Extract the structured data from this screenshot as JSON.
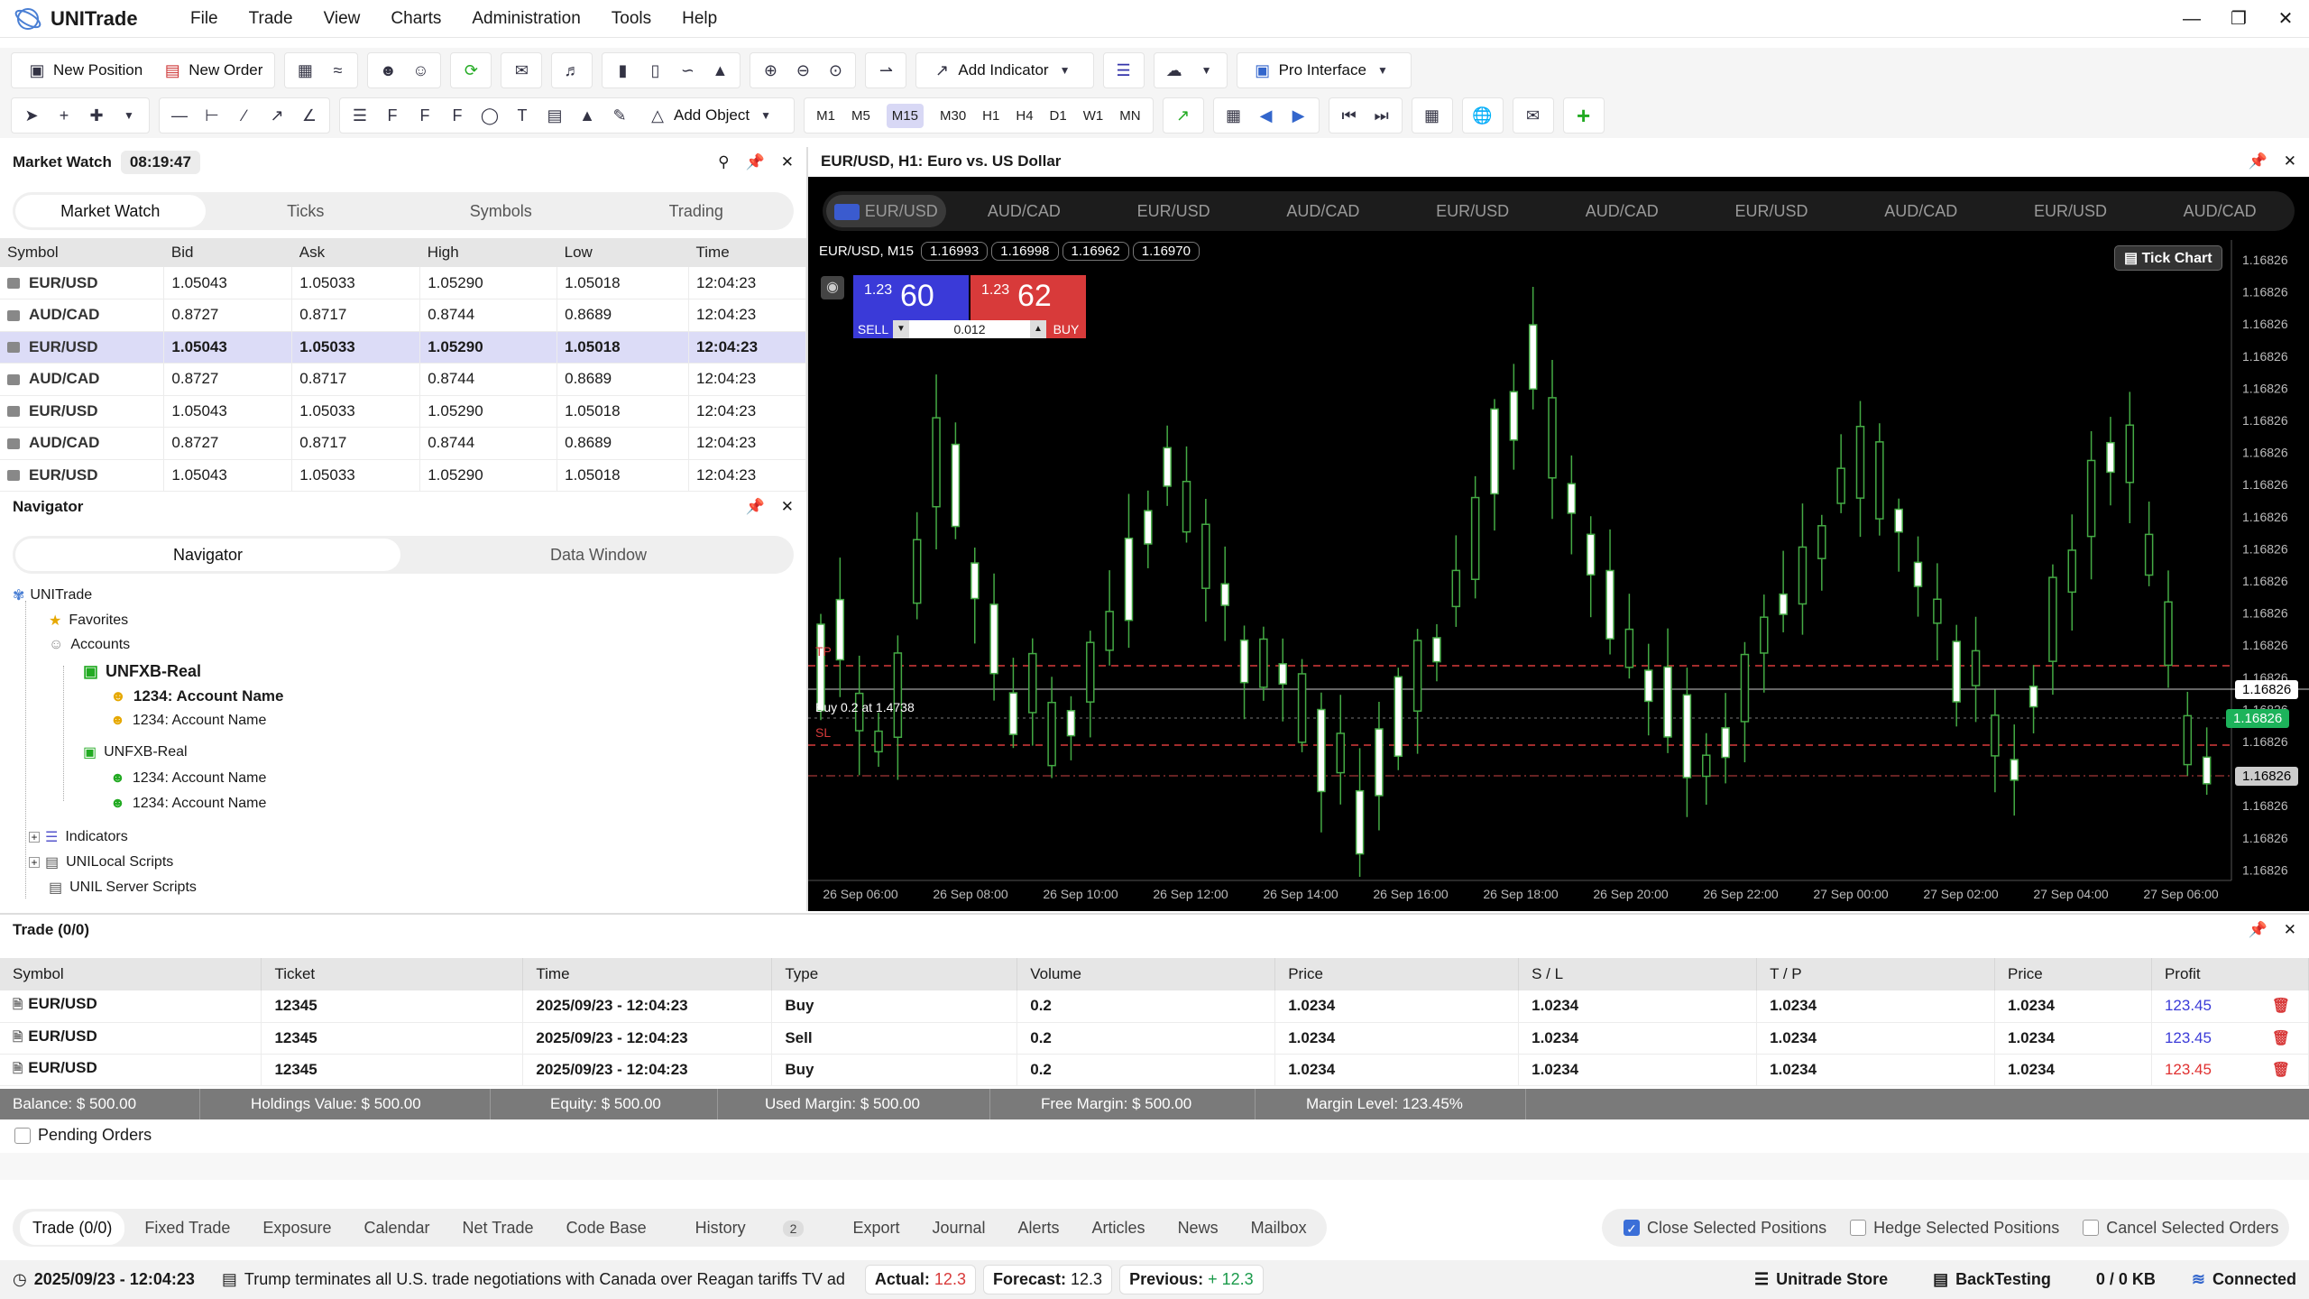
{
  "app": {
    "title": "UNITrade"
  },
  "menu": [
    "File",
    "Trade",
    "View",
    "Charts",
    "Administration",
    "Tools",
    "Help"
  ],
  "toolbar": {
    "new_position": "New Position",
    "new_order": "New Order",
    "add_indicator": "Add Indicator",
    "pro_interface": "Pro Interface",
    "add_object": "Add Object"
  },
  "timeframes": [
    "M1",
    "M5",
    "M15",
    "M30",
    "H1",
    "H4",
    "D1",
    "W1",
    "MN"
  ],
  "selected_timeframe": "M15",
  "market_watch": {
    "title": "Market Watch",
    "time": "08:19:47",
    "tabs": [
      "Market Watch",
      "Ticks",
      "Symbols",
      "Trading"
    ],
    "columns": [
      "Symbol",
      "Bid",
      "Ask",
      "High",
      "Low",
      "Time"
    ],
    "rows": [
      [
        "EUR/USD",
        "1.05043",
        "1.05033",
        "1.05290",
        "1.05018",
        "12:04:23"
      ],
      [
        "AUD/CAD",
        "0.8727",
        "0.8717",
        "0.8744",
        "0.8689",
        "12:04:23"
      ],
      [
        "EUR/USD",
        "1.05043",
        "1.05033",
        "1.05290",
        "1.05018",
        "12:04:23"
      ],
      [
        "AUD/CAD",
        "0.8727",
        "0.8717",
        "0.8744",
        "0.8689",
        "12:04:23"
      ],
      [
        "EUR/USD",
        "1.05043",
        "1.05033",
        "1.05290",
        "1.05018",
        "12:04:23"
      ],
      [
        "AUD/CAD",
        "0.8727",
        "0.8717",
        "0.8744",
        "0.8689",
        "12:04:23"
      ],
      [
        "EUR/USD",
        "1.05043",
        "1.05033",
        "1.05290",
        "1.05018",
        "12:04:23"
      ]
    ]
  },
  "navigator": {
    "title": "Navigator",
    "tabs": [
      "Navigator",
      "Data Window"
    ],
    "root": "UNITrade",
    "favorites": "Favorites",
    "accounts": "Accounts",
    "real1": "UNFXB-Real",
    "acc1": "1234: Account Name",
    "acc2": "1234: Account Name",
    "real2": "UNFXB-Real",
    "acc3": "1234: Account Name",
    "acc4": "1234: Account Name",
    "indicators": "Indicators",
    "local_scripts": "UNILocal Scripts",
    "server_scripts": "UNIL Server Scripts"
  },
  "chart": {
    "header": "EUR/USD, H1: Euro vs. US Dollar",
    "tabs": [
      "EUR/USD",
      "AUD/CAD",
      "EUR/USD",
      "AUD/CAD",
      "EUR/USD",
      "AUD/CAD",
      "EUR/USD",
      "AUD/CAD",
      "EUR/USD",
      "AUD/CAD"
    ],
    "symbol_info": "EUR/USD, M15",
    "ohlc": [
      "1.16993",
      "1.16998",
      "1.16962",
      "1.16970"
    ],
    "tick_chart": "Tick Chart",
    "sell_small": "1.23",
    "sell_big": "60",
    "buy_small": "1.23",
    "buy_big": "62",
    "sell": "SELL",
    "buy": "BUY",
    "lot": "0.012",
    "tp": "TP",
    "sl": "SL",
    "position_label": "Buy 0.2 at 1.4738",
    "price_labels": [
      "1.16826",
      "1.16826",
      "1.16826"
    ],
    "y_ticks": [
      "1.16826",
      "1.16826",
      "1.16826",
      "1.16826",
      "1.16826",
      "1.16826",
      "1.16826",
      "1.16826",
      "1.16826",
      "1.16826",
      "1.16826",
      "1.16826",
      "1.16826",
      "1.16826",
      "1.16826",
      "1.16826",
      "1.16826",
      "1.16826",
      "1.16826",
      "1.16826"
    ],
    "x_ticks": [
      "26 Sep 06:00",
      "26 Sep 08:00",
      "26 Sep 10:00",
      "26 Sep 12:00",
      "26 Sep 14:00",
      "26 Sep 16:00",
      "26 Sep 18:00",
      "26 Sep 20:00",
      "26 Sep 22:00",
      "27 Sep 00:00",
      "27 Sep 02:00",
      "27 Sep 04:00",
      "27 Sep 06:00"
    ]
  },
  "trade": {
    "title": "Trade (0/0)",
    "columns": [
      "Symbol",
      "Ticket",
      "Time",
      "Type",
      "Volume",
      "Price",
      "S / L",
      "T / P",
      "Price",
      "Profit"
    ],
    "rows": [
      [
        "EUR/USD",
        "12345",
        "2025/09/23 - 12:04:23",
        "Buy",
        "0.2",
        "1.0234",
        "1.0234",
        "1.0234",
        "1.0234",
        "123.45"
      ],
      [
        "EUR/USD",
        "12345",
        "2025/09/23 - 12:04:23",
        "Sell",
        "0.2",
        "1.0234",
        "1.0234",
        "1.0234",
        "1.0234",
        "123.45"
      ],
      [
        "EUR/USD",
        "12345",
        "2025/09/23 - 12:04:23",
        "Buy",
        "0.2",
        "1.0234",
        "1.0234",
        "1.0234",
        "1.0234",
        "123.45"
      ]
    ],
    "profit_colors": [
      "#3b3bd8",
      "#3b3bd8",
      "#e03030"
    ],
    "balance": [
      "Balance: $ 500.00",
      "Holdings Value: $ 500.00",
      "Equity: $ 500.00",
      "Used Margin: $ 500.00",
      "Free Margin: $ 500.00",
      "Margin Level: 123.45%"
    ],
    "pending": "Pending Orders"
  },
  "bottom_tabs": [
    "Trade (0/0)",
    "Fixed Trade",
    "Exposure",
    "Calendar",
    "Net Trade",
    "Code Base",
    "History",
    "Export",
    "Journal",
    "Alerts",
    "Articles",
    "News",
    "Mailbox"
  ],
  "history_badge": "2",
  "options": [
    "Close Selected Positions",
    "Hedge Selected Positions",
    "Cancel Selected Orders"
  ],
  "status": {
    "datetime": "2025/09/23 - 12:04:23",
    "news": "Trump terminates all U.S. trade negotiations with Canada over Reagan tariffs TV ad",
    "actual_label": "Actual:",
    "actual": "12.3",
    "forecast_label": "Forecast:",
    "forecast": "12.3",
    "previous_label": "Previous:",
    "previous": "+ 12.3",
    "store": "Unitrade Store",
    "backtesting": "BackTesting",
    "traffic": "0 / 0 KB",
    "connected": "Connected"
  }
}
